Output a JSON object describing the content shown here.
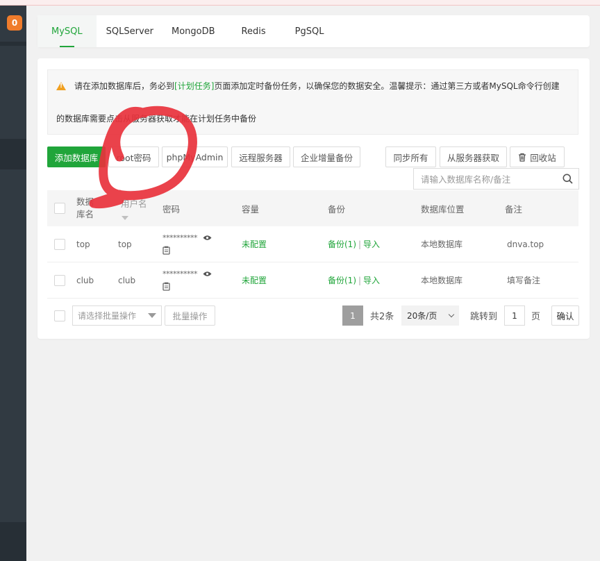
{
  "sidebar": {
    "badge": "0"
  },
  "tabs": [
    {
      "label": "MySQL",
      "active": true
    },
    {
      "label": "SQLServer"
    },
    {
      "label": "MongoDB"
    },
    {
      "label": "Redis"
    },
    {
      "label": "PgSQL"
    }
  ],
  "alert": {
    "text_before": "请在添加数据库后，务必到",
    "link": "[计划任务]",
    "text_after": "页面添加定时备份任务，以确保您的数据安全。温馨提示：通过第三方或者MySQL命令行创建",
    "line2": "的数据库需要点击从服务器获取才能在计划任务中备份"
  },
  "toolbar": {
    "add_db": "添加数据库",
    "root_password": "root密码",
    "phpmyadmin": "phpMyAdmin",
    "remote_server": "远程服务器",
    "enterprise_backup": "企业增量备份",
    "sync_all": "同步所有",
    "get_from_server": "从服务器获取",
    "recycle_bin": "回收站"
  },
  "search": {
    "placeholder": "请输入数据库名称/备注"
  },
  "table": {
    "headers": {
      "db_name": "数据库名",
      "username": "用户名",
      "password": "密码",
      "capacity": "容量",
      "backup": "备份",
      "location": "数据库位置",
      "note": "备注"
    },
    "rows": [
      {
        "db_name": "top",
        "username": "top",
        "password": "**********",
        "capacity": "未配置",
        "backup": "备份(1)",
        "sep": "|",
        "import": "导入",
        "location": "本地数据库",
        "note": "dnva.top"
      },
      {
        "db_name": "club",
        "username": "club",
        "password": "**********",
        "capacity": "未配置",
        "backup": "备份(1)",
        "sep": "|",
        "import": "导入",
        "location": "本地数据库",
        "note": "填写备注"
      }
    ]
  },
  "footer": {
    "batch_placeholder": "请选择批量操作",
    "batch_button": "批量操作",
    "current_page": "1",
    "total": "共2条",
    "per_page": "20条/页",
    "jump_label": "跳转到",
    "jump_value": "1",
    "page_unit": "页",
    "confirm": "确认"
  },
  "colors": {
    "accent": "#20a53a",
    "sidebar": "#313a42",
    "badge": "#f07c2c",
    "annotation": "#e8323c"
  }
}
